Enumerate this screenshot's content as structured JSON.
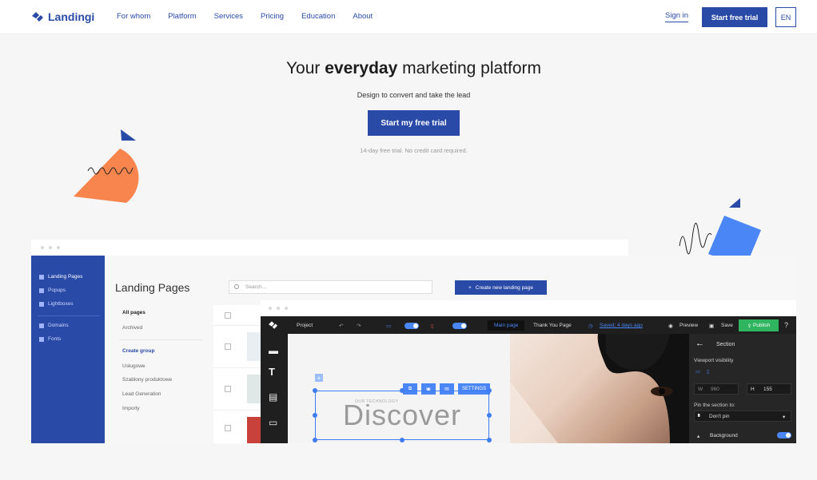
{
  "nav": {
    "brand": "Landingi",
    "items": [
      "For whom",
      "Platform",
      "Services",
      "Pricing",
      "Education",
      "About"
    ],
    "signin": "Sign in",
    "cta": "Start free trial",
    "lang": "EN"
  },
  "hero": {
    "title_pre": "Your ",
    "title_bold": "everyday",
    "title_post": " marketing platform",
    "subtitle": "Design to convert and take the lead",
    "cta": "Start my free trial",
    "note": "14-day free trial. No credit card required."
  },
  "app": {
    "sidebar": [
      "Landing Pages",
      "Popups",
      "Lightboxes",
      "Domains",
      "Fonts"
    ],
    "title": "Landing Pages",
    "search_placeholder": "Search...",
    "create_button": "Create new landing page",
    "menu": {
      "all_pages": "All pages",
      "archived": "Archived",
      "create_group": "Create group",
      "groups": [
        "Usługowe",
        "Szablony produktowe",
        "Lead Generation",
        "Importy"
      ]
    }
  },
  "editor": {
    "project": "Project",
    "main_page": "Main page",
    "thank_you_page": "Thank You Page",
    "saved": "Saved: 4 days ago",
    "preview": "Preview",
    "save": "Save",
    "publish": "Publish",
    "help": "?",
    "headline": "Discover",
    "eyebrow": "OUR TECHNOLOGY",
    "settings": "SETTINGS",
    "panel": {
      "section": "Section",
      "viewport": "Viewport visibility",
      "w_label": "W",
      "w_value": "960",
      "h_label": "H",
      "h_value": "155",
      "pin_label": "Pin the section to:",
      "pin_value": "Don't pin",
      "background": "Background"
    }
  },
  "colors": {
    "brand": "#2a4aa8",
    "accent_orange": "#f8854d",
    "accent_blue": "#4a86f5",
    "publish_green": "#2fb55f"
  }
}
